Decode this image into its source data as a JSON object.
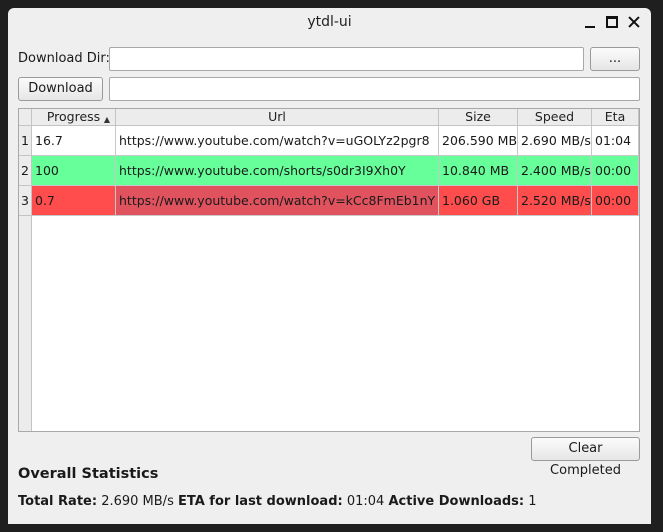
{
  "window": {
    "title": "ytdl-ui"
  },
  "form": {
    "download_dir_label": "Download Dir:",
    "download_dir_value": "",
    "browse_label": "...",
    "download_label": "Download",
    "url_value": ""
  },
  "table": {
    "columns": [
      "Progress",
      "Url",
      "Size",
      "Speed",
      "Eta"
    ],
    "row_numbers": [
      "1",
      "2",
      "3"
    ],
    "rows": [
      {
        "progress": "16.7",
        "url": "https://www.youtube.com/watch?v=uGOLYz2pgr8",
        "size": "206.590 MB",
        "speed": "2.690 MB/s",
        "eta": "01:04"
      },
      {
        "progress": "100",
        "url": "https://www.youtube.com/shorts/s0dr3I9Xh0Y",
        "size": "10.840 MB",
        "speed": "2.400 MB/s",
        "eta": "00:00"
      },
      {
        "progress": "0.7",
        "url": "https://www.youtube.com/watch?v=kCc8FmEb1nY",
        "size": "1.060 GB",
        "speed": "2.520 MB/s",
        "eta": "00:00"
      }
    ],
    "row_colors": {
      "in_progress": "#ffffff",
      "completed": "#66ff99",
      "failed": "#ff4d4d"
    }
  },
  "clear_completed_label": "Clear Completed",
  "stats": {
    "title": "Overall Statistics",
    "total_rate_label": "Total Rate:",
    "total_rate_value": "2.690 MB/s",
    "eta_label": "ETA for last download:",
    "eta_value": "01:04",
    "active_label": "Active Downloads:",
    "active_value": "1"
  }
}
